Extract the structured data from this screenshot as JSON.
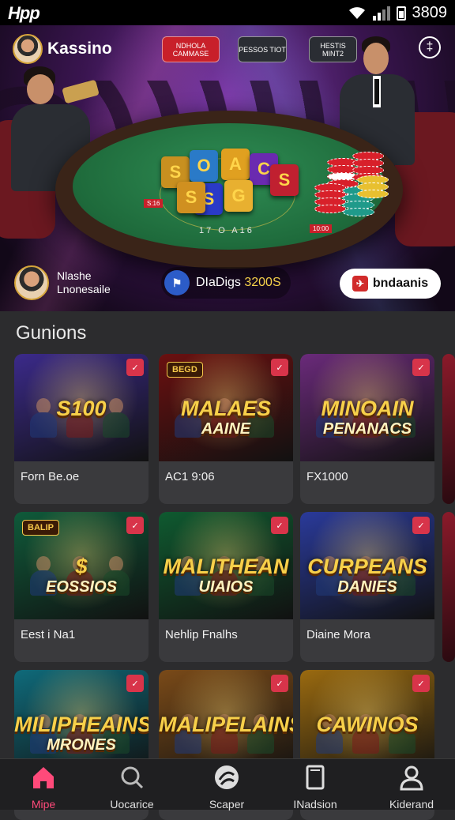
{
  "status_bar": {
    "app_name": "Hpp",
    "time": "3809"
  },
  "header": {
    "brand": "Kassino",
    "pills": [
      {
        "label": "NDHOLA CAMMASE",
        "color": "#c8202a"
      },
      {
        "label": "PESSOS TIOT",
        "color": "#2a2d33"
      },
      {
        "label": "HESTIS MINT2",
        "color": "#2a2d33"
      }
    ],
    "menu_icon": "menu-icon"
  },
  "hero": {
    "tiles": [
      "S",
      "O",
      "A",
      "C",
      "S",
      "S",
      "G",
      "S"
    ],
    "table_text": "17 O A16",
    "tags": [
      "S:16",
      "10:00"
    ]
  },
  "user": {
    "name_line1": "Nlashe",
    "name_line2": "Lnonesaile"
  },
  "coins": {
    "label": "DIaDigs",
    "amount": "3200S"
  },
  "cta": {
    "label": "bndaanis"
  },
  "section": {
    "title": "Gunions"
  },
  "games": [
    {
      "title": "Forn Be.oe",
      "art_line1": "S100",
      "art_line2": "",
      "badge": "",
      "bg": "#3b2a8a"
    },
    {
      "title": "AC1 9:06",
      "art_line1": "MALAES",
      "art_line2": "AAINE",
      "badge": "BEGD",
      "bg": "#6a1010"
    },
    {
      "title": "FX1000",
      "art_line1": "MINOAIN",
      "art_line2": "PENANACS",
      "badge": "",
      "bg": "#6a2a7a"
    },
    {
      "title": "Eest i Na1",
      "art_line1": "$",
      "art_line2": "EOSSIOS",
      "badge": "BALIP",
      "bg": "#0f5a3a"
    },
    {
      "title": "Nehlip Fnalhs",
      "art_line1": "MALITHEAN",
      "art_line2": "UIAIOS",
      "badge": "",
      "bg": "#0f5a30"
    },
    {
      "title": "Diaine Mora",
      "art_line1": "CURPEANS",
      "art_line2": "DANIES",
      "badge": "",
      "bg": "#2a3a9a"
    },
    {
      "title": "",
      "art_line1": "MILIPHEAINS",
      "art_line2": "MRONES",
      "badge": "",
      "bg": "#0f6a7a"
    },
    {
      "title": "",
      "art_line1": "MALIPELAINS",
      "art_line2": "",
      "badge": "",
      "bg": "#7a4a18"
    },
    {
      "title": "",
      "art_line1": "CAWINOS",
      "art_line2": "",
      "badge": "",
      "bg": "#9a6a10"
    }
  ],
  "nav": [
    {
      "label": "Mipe",
      "icon": "home-icon",
      "active": true
    },
    {
      "label": "Uocarice",
      "icon": "search-icon",
      "active": false
    },
    {
      "label": "Scaper",
      "icon": "spin-icon",
      "active": false
    },
    {
      "label": "INadsion",
      "icon": "device-icon",
      "active": false
    },
    {
      "label": "Kiderand",
      "icon": "profile-icon",
      "active": false
    }
  ],
  "colors": {
    "accent": "#ff4a7a",
    "bg": "#2c2c2e",
    "card": "#3a3a3d"
  }
}
